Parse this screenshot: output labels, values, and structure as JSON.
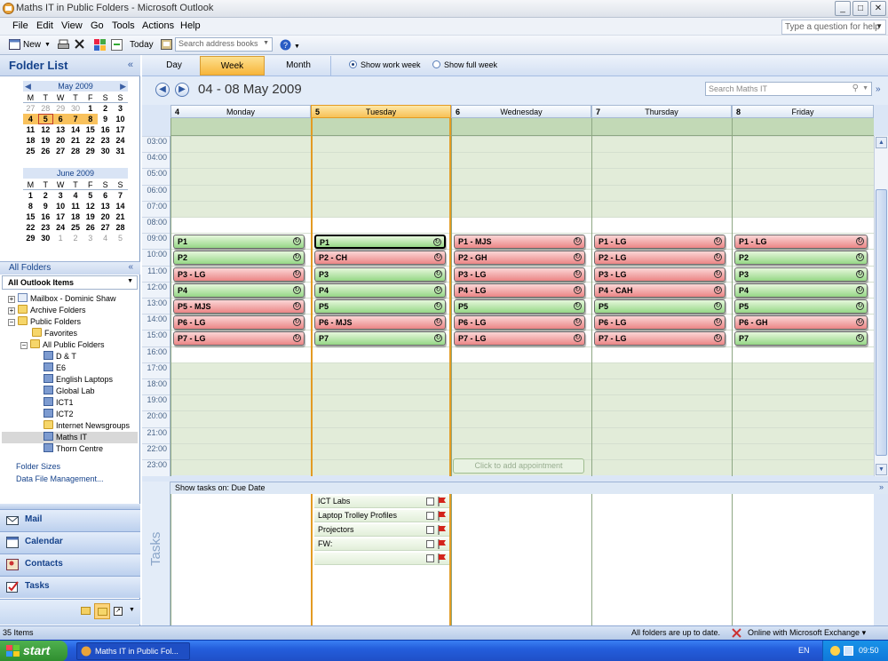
{
  "window": {
    "title": "Maths IT in Public Folders - Microsoft Outlook",
    "help_placeholder": "Type a question for help"
  },
  "menu": [
    "File",
    "Edit",
    "View",
    "Go",
    "Tools",
    "Actions",
    "Help"
  ],
  "toolbar": {
    "new_label": "New",
    "today_label": "Today",
    "address_placeholder": "Search address books"
  },
  "folder_list": {
    "title": "Folder List",
    "may": {
      "month": "May 2009",
      "dow": [
        "M",
        "T",
        "W",
        "T",
        "F",
        "S",
        "S"
      ],
      "days": [
        27,
        28,
        29,
        30,
        1,
        2,
        3,
        4,
        5,
        6,
        7,
        8,
        9,
        10,
        11,
        12,
        13,
        14,
        15,
        16,
        17,
        18,
        19,
        20,
        21,
        22,
        23,
        24,
        25,
        26,
        27,
        28,
        29,
        30,
        31
      ]
    },
    "june": {
      "month": "June 2009",
      "dow": [
        "M",
        "T",
        "W",
        "T",
        "F",
        "S",
        "S"
      ],
      "days": [
        1,
        2,
        3,
        4,
        5,
        6,
        7,
        8,
        9,
        10,
        11,
        12,
        13,
        14,
        15,
        16,
        17,
        18,
        19,
        20,
        21,
        22,
        23,
        24,
        25,
        26,
        27,
        28,
        29,
        30,
        1,
        2,
        3,
        4,
        5
      ]
    },
    "all_folders": "All Folders",
    "all_outlook_items": "All Outlook Items",
    "tree": [
      "Mailbox - Dominic Shaw",
      "Archive Folders",
      "Public Folders",
      "Favorites",
      "All Public Folders",
      "D & T",
      "E6",
      "English Laptops",
      "Global Lab",
      "ICT1",
      "ICT2",
      "Internet Newsgroups",
      "Maths IT",
      "Thorn Centre"
    ],
    "folder_sizes": "Folder Sizes",
    "data_file": "Data File Management..."
  },
  "nav": {
    "mail": "Mail",
    "calendar": "Calendar",
    "contacts": "Contacts",
    "tasks": "Tasks"
  },
  "view": {
    "tabs": [
      "Day",
      "Week",
      "Month"
    ],
    "show_work_week": "Show work week",
    "show_full_week": "Show full week",
    "date_range": "04 - 08 May 2009",
    "search_placeholder": "Search Maths IT",
    "days": [
      {
        "num": "4",
        "name": "Monday"
      },
      {
        "num": "5",
        "name": "Tuesday"
      },
      {
        "num": "6",
        "name": "Wednesday"
      },
      {
        "num": "7",
        "name": "Thursday"
      },
      {
        "num": "8",
        "name": "Friday"
      }
    ],
    "times": [
      "03:00",
      "04:00",
      "05:00",
      "06:00",
      "07:00",
      "08:00",
      "09:00",
      "10:00",
      "11:00",
      "12:00",
      "13:00",
      "14:00",
      "15:00",
      "16:00",
      "17:00",
      "18:00",
      "19:00",
      "20:00",
      "21:00",
      "22:00",
      "23:00"
    ],
    "appointments": [
      [
        {
          "t": "P1",
          "c": "g"
        },
        {
          "t": "P2",
          "c": "g"
        },
        {
          "t": "P3 - LG",
          "c": "r"
        },
        {
          "t": "P4",
          "c": "g"
        },
        {
          "t": "P5 - MJS",
          "c": "r"
        },
        {
          "t": "P6 - LG",
          "c": "r"
        },
        {
          "t": "P7 - LG",
          "c": "r"
        }
      ],
      [
        {
          "t": "P1",
          "c": "g"
        },
        {
          "t": "P2 - CH",
          "c": "r"
        },
        {
          "t": "P3",
          "c": "g"
        },
        {
          "t": "P4",
          "c": "g"
        },
        {
          "t": "P5",
          "c": "g"
        },
        {
          "t": "P6 - MJS",
          "c": "r"
        },
        {
          "t": "P7",
          "c": "g"
        }
      ],
      [
        {
          "t": "P1 - MJS",
          "c": "r"
        },
        {
          "t": "P2 - GH",
          "c": "r"
        },
        {
          "t": "P3 - LG",
          "c": "r"
        },
        {
          "t": "P4 - LG",
          "c": "r"
        },
        {
          "t": "P5",
          "c": "g"
        },
        {
          "t": "P6 - LG",
          "c": "r"
        },
        {
          "t": "P7 - LG",
          "c": "r"
        }
      ],
      [
        {
          "t": "P1 - LG",
          "c": "r"
        },
        {
          "t": "P2 - LG",
          "c": "r"
        },
        {
          "t": "P3 - LG",
          "c": "r"
        },
        {
          "t": "P4 - CAH",
          "c": "r"
        },
        {
          "t": "P5",
          "c": "g"
        },
        {
          "t": "P6 - LG",
          "c": "r"
        },
        {
          "t": "P7 - LG",
          "c": "r"
        }
      ],
      [
        {
          "t": "P1 - LG",
          "c": "r"
        },
        {
          "t": "P2",
          "c": "g"
        },
        {
          "t": "P3",
          "c": "g"
        },
        {
          "t": "P4",
          "c": "g"
        },
        {
          "t": "P5",
          "c": "g"
        },
        {
          "t": "P6 - GH",
          "c": "r"
        },
        {
          "t": "P7",
          "c": "g"
        }
      ]
    ],
    "click_to_add": "Click to add appointment",
    "show_tasks_on": "Show tasks on: Due Date",
    "tasks_label": "Tasks",
    "tasks": [
      "ICT Labs",
      "Laptop Trolley Profiles",
      "Projectors",
      "FW:",
      ""
    ]
  },
  "status": {
    "items": "35 Items",
    "folders": "All folders are up to date.",
    "exchange": "Online with Microsoft Exchange"
  },
  "taskbar": {
    "start": "start",
    "item": "Maths IT in Public Fol...",
    "lang": "EN",
    "time": "09:50"
  },
  "colors": {
    "green_appt": "#96d786",
    "red_appt": "#eb8686",
    "today": "#f8c156",
    "selected_date": "#f9c25d"
  }
}
